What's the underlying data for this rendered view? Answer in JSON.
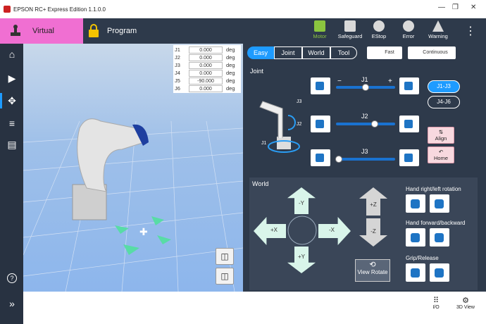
{
  "window": {
    "title": "EPSON RC+ Express Edition 1.1.0.0",
    "min": "—",
    "restore": "❐",
    "close": "✕"
  },
  "topbar": {
    "virtual": "Virtual",
    "program": "Program",
    "buttons": [
      {
        "label": "Motor",
        "color": "#8bc53f"
      },
      {
        "label": "Safeguard"
      },
      {
        "label": "EStop"
      },
      {
        "label": "Error"
      },
      {
        "label": "Warning"
      }
    ],
    "menu": "⋮"
  },
  "joints": [
    {
      "name": "J1",
      "value": "0.000",
      "unit": "deg"
    },
    {
      "name": "J2",
      "value": "0.000",
      "unit": "deg"
    },
    {
      "name": "J3",
      "value": "0.000",
      "unit": "deg"
    },
    {
      "name": "J4",
      "value": "0.000",
      "unit": "deg"
    },
    {
      "name": "J5",
      "value": "-90.000",
      "unit": "deg"
    },
    {
      "name": "J6",
      "value": "0.000",
      "unit": "deg"
    }
  ],
  "modes": [
    "Easy",
    "Joint",
    "World",
    "Tool"
  ],
  "speed": {
    "fast": "Fast",
    "continuous": "Continuous"
  },
  "joint_panel": {
    "title": "Joint",
    "minus": "−",
    "plus": "+",
    "sliders": [
      {
        "label": "J1",
        "value": 0.5
      },
      {
        "label": "J2",
        "value": 0.65
      },
      {
        "label": "J3",
        "value": 0.05
      }
    ],
    "group1": "J1-J3",
    "group2": "J4-J6",
    "align": "Align",
    "home": "Home",
    "robot_labels": [
      "J3",
      "J2",
      "J1"
    ]
  },
  "world_panel": {
    "title": "World",
    "py": "+Y",
    "ny": "-Y",
    "px": "+X",
    "nx": "-X",
    "pz": "+Z",
    "nz": "-Z",
    "view_rotate": "View Rotate",
    "hand_rot": "Hand right/left rotation",
    "hand_fb": "Hand forward/backward",
    "grip": "Grip/Release"
  },
  "bottombar": {
    "io": "I/O",
    "view3d": "3D View"
  },
  "leftbar": {
    "help": "?",
    "expand": "»"
  }
}
